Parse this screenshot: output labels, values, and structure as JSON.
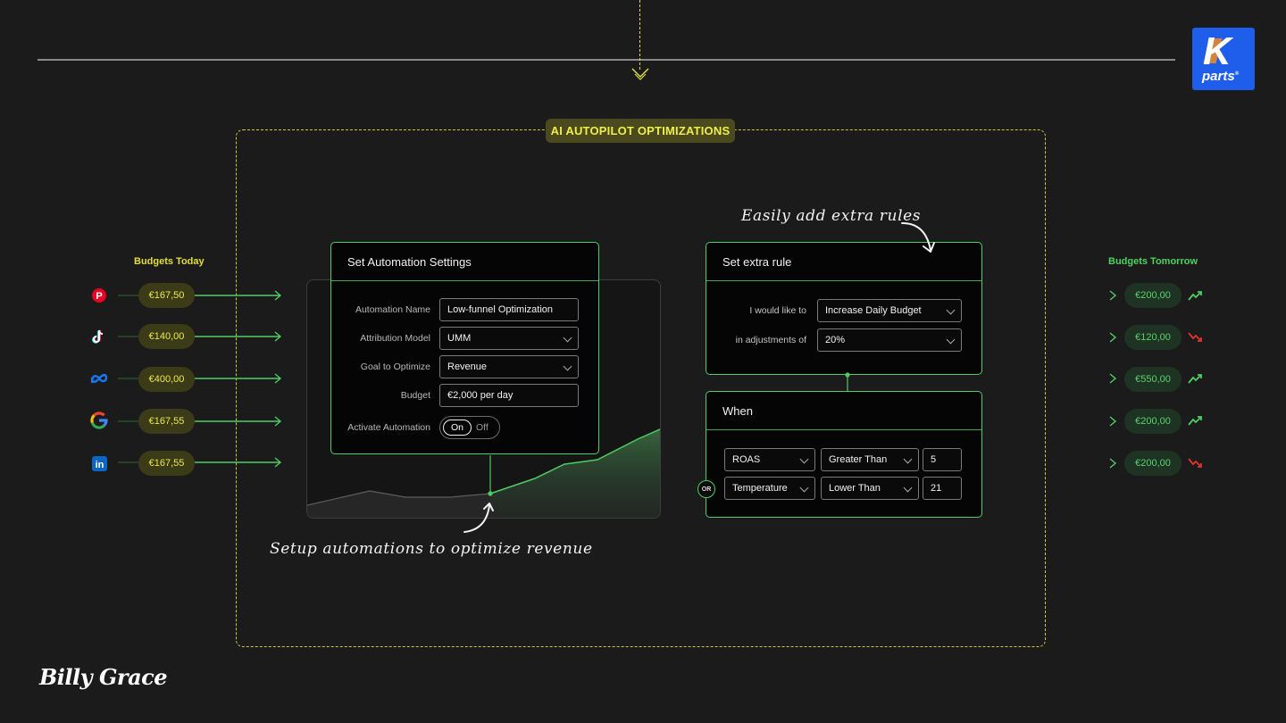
{
  "header": {
    "badge": "AI AUTOPILOT OPTIMIZATIONS",
    "logo": {
      "text": "K",
      "subtext": "parts",
      "superscript": "®",
      "color": "#1f5eea",
      "accent": "#f58a1f"
    }
  },
  "budgets_today": {
    "heading": "Budgets Today",
    "items": [
      {
        "platform": "pinterest-icon",
        "value": "€167,50"
      },
      {
        "platform": "tiktok-icon",
        "value": "€140,00"
      },
      {
        "platform": "meta-icon",
        "value": "€400,00"
      },
      {
        "platform": "google-icon",
        "value": "€167,55"
      },
      {
        "platform": "linkedin-icon",
        "value": "€167,55"
      }
    ]
  },
  "budgets_tomorrow": {
    "heading": "Budgets Tomorrow",
    "items": [
      {
        "value": "€200,00",
        "trend": "up"
      },
      {
        "value": "€120,00",
        "trend": "down"
      },
      {
        "value": "€550,00",
        "trend": "up"
      },
      {
        "value": "€200,00",
        "trend": "up"
      },
      {
        "value": "€200,00",
        "trend": "down"
      }
    ]
  },
  "automation_settings": {
    "title": "Set Automation Settings",
    "automation_name_label": "Automation Name",
    "automation_name_value": "Low-funnel Optimization",
    "attribution_model_label": "Attribution Model",
    "attribution_model_value": "UMM",
    "goal_label": "Goal to Optimize",
    "goal_value": "Revenue",
    "budget_label": "Budget",
    "budget_value": "€2,000 per day",
    "activate_label": "Activate Automation",
    "toggle_on": "On",
    "toggle_off": "Off"
  },
  "extra_rule": {
    "title": "Set extra rule",
    "action_label": "I would like to",
    "action_value": "Increase Daily Budget",
    "adjustment_label": "in adjustments of",
    "adjustment_value": "20%"
  },
  "when": {
    "title": "When",
    "or_label": "OR",
    "conditions": [
      {
        "metric": "ROAS",
        "operator": "Greater Than",
        "value": "5"
      },
      {
        "metric": "Temperature",
        "operator": "Lower Than",
        "value": "21"
      }
    ]
  },
  "annotations": {
    "extra_rules": "Easily add extra rules",
    "setup": "Setup automations to optimize revenue"
  },
  "footer": {
    "brand": "Billy Grace"
  },
  "colors": {
    "accent_yellow": "#e3df3e",
    "accent_green": "#4fcc63",
    "trend_down": "#e0342b",
    "background": "#1b1b1b"
  }
}
